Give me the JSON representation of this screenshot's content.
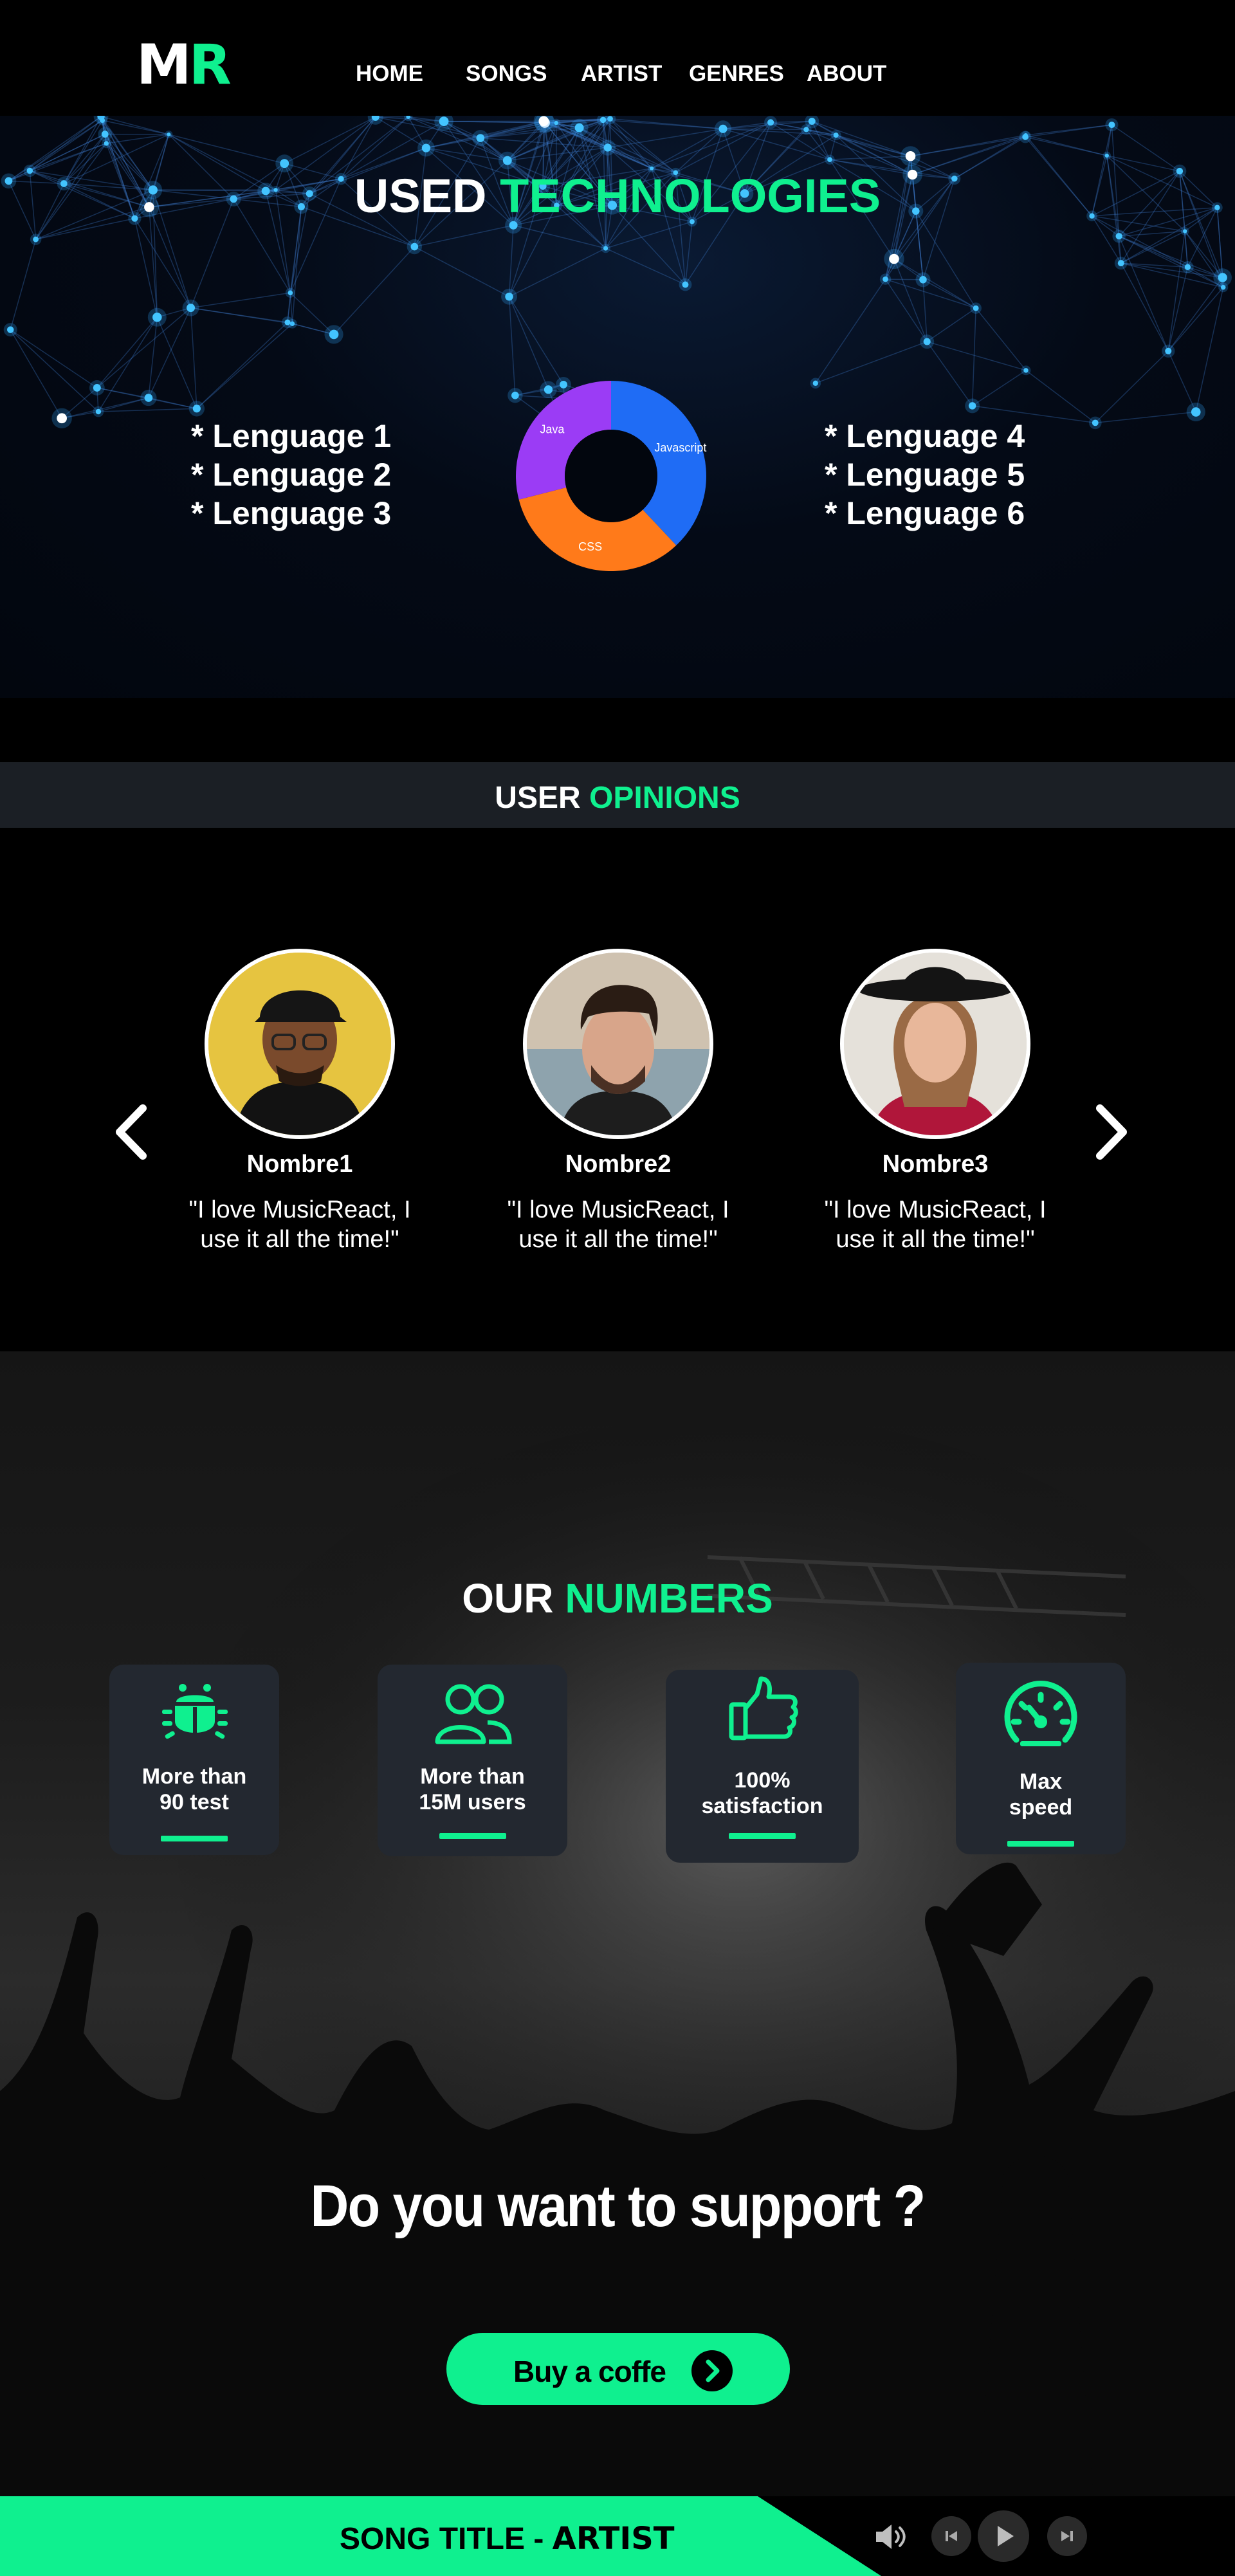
{
  "nav": {
    "logo_m": "M",
    "logo_r": "R",
    "links": [
      "HOME",
      "SONGS",
      "ARTIST",
      "GENRES",
      "ABOUT"
    ]
  },
  "tech": {
    "title_white": "USED",
    "title_green": "TECHNOLOGIES",
    "left_list": [
      "* Lenguage 1",
      "* Lenguage 2",
      "* Lenguage 3"
    ],
    "right_list": [
      "* Lenguage 4",
      "* Lenguage 5",
      "* Lenguage 6"
    ],
    "chart_data": {
      "type": "pie",
      "categories": [
        "Javascript",
        "CSS",
        "Java"
      ],
      "values": [
        38,
        33,
        29
      ],
      "colors": [
        "#1f6cf5",
        "#ff7a1a",
        "#9b3cf5"
      ],
      "title": ""
    }
  },
  "opinions": {
    "title_white": "USER",
    "title_green": "OPINIONS",
    "people": [
      {
        "name": "Nombre1",
        "quote": "\"I love MusicReact, I use it all the time!\""
      },
      {
        "name": "Nombre2",
        "quote": "\"I love MusicReact, I use it all the time!\""
      },
      {
        "name": "Nombre3",
        "quote": "\"I love MusicReact, I use it all the time!\""
      }
    ]
  },
  "numbers": {
    "title_white": "OUR",
    "title_green": "NUMBERS",
    "cards": [
      {
        "line1": "More than",
        "line2": "90 test",
        "icon": "bug-icon"
      },
      {
        "line1": "More than",
        "line2": "15M users",
        "icon": "users-icon"
      },
      {
        "line1": "100%",
        "line2": "satisfaction",
        "icon": "thumbs-up-icon"
      },
      {
        "line1": "Max",
        "line2": "speed",
        "icon": "speedometer-icon"
      }
    ]
  },
  "support": {
    "question": "Do you want to support ?",
    "button_label": "Buy a coffe"
  },
  "player": {
    "song_title": "SONG TITLE -",
    "artist": "ARTIST"
  },
  "colors": {
    "accent": "#0ff08f",
    "panel": "#232830",
    "bar": "#1b1f25"
  }
}
